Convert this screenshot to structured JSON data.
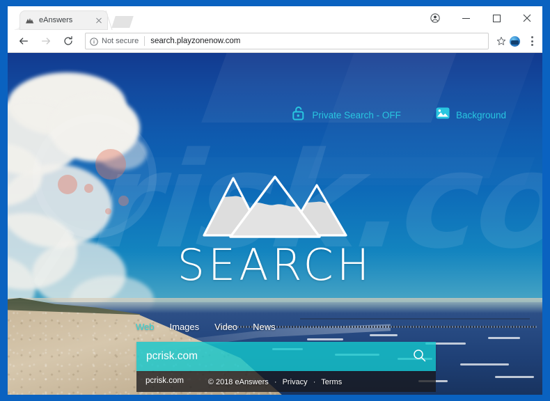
{
  "browser": {
    "tab": {
      "title": "eAnswers",
      "favicon_icon": "mountain-logo-icon",
      "close_icon": "close-icon"
    },
    "new_tab_icon": "new-tab-icon",
    "window_controls": {
      "profile_icon": "profile-icon",
      "minimize_icon": "minimize-icon",
      "maximize_icon": "maximize-icon",
      "close_icon": "close-window-icon"
    },
    "toolbar": {
      "back_icon": "back-arrow-icon",
      "forward_icon": "forward-arrow-icon",
      "reload_icon": "reload-icon",
      "security_icon": "info-circle-icon",
      "security_label": "Not secure",
      "url": "search.playzonenow.com",
      "bookmark_icon": "star-icon",
      "extension_icon": "extension-avatar-icon",
      "menu_icon": "three-dot-menu-icon"
    }
  },
  "page": {
    "topnav": [
      {
        "label": "Private Search - OFF",
        "icon": "open-padlock-icon"
      },
      {
        "label": "Background",
        "icon": "image-picture-icon"
      }
    ],
    "logo": {
      "wordmark": "SEARCH",
      "icon": "three-mountains-icon"
    },
    "tabs": [
      {
        "label": "Web",
        "active": true
      },
      {
        "label": "Images",
        "active": false
      },
      {
        "label": "Video",
        "active": false
      },
      {
        "label": "News",
        "active": false
      }
    ],
    "search": {
      "value": "pcrisk.com",
      "placeholder": "",
      "button_icon": "magnifier-icon",
      "suggestions": [
        "pcrisk.com"
      ]
    },
    "footer": {
      "copyright": "© 2018 eAnswers",
      "sep1": "·",
      "privacy": "Privacy",
      "sep2": "·",
      "terms": "Terms"
    }
  },
  "colors": {
    "window_frame": "#0a63c2",
    "accent_cyan": "#29c6e0",
    "search_box": "#14c8cd",
    "active_tab_text": "#2fd3d6"
  }
}
